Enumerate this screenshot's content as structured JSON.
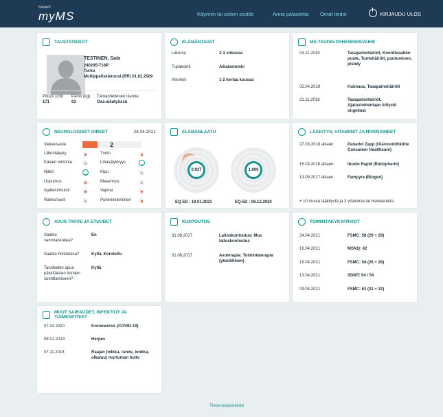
{
  "header": {
    "logo_small": "Stellar©",
    "logo_big": "myMS",
    "nav": [
      "Käynnin tai soiton sisältö",
      "Anna palautetta",
      "Omat tiedot"
    ],
    "logout": "KIRJAUDU ULOS"
  },
  "tausta": {
    "title": "TAUSTATIEDOT",
    "name": "TESTINEN, Salo",
    "id": "240295-716P",
    "city": "Turku",
    "diagnosis": "Multippeliskleroosi (RR) 01.02.2009",
    "height_label": "Pituus (cm)",
    "height": "171",
    "weight_label": "Paino (kg)",
    "weight": "63",
    "status_label": "Tämänhetkinen tilanne",
    "status": "Osa-aikatyössä"
  },
  "elama": {
    "title": "ELÄMÄNTAVAT",
    "rows": [
      {
        "label": "Liikunta",
        "value": "2-3 viikossa"
      },
      {
        "label": "Tupakointi",
        "value": "Aikaisemmin"
      },
      {
        "label": "Alkoholi",
        "value": "1-2 kertaa kuussa"
      }
    ]
  },
  "pahen": {
    "title": "MS-TAUDIN PAHENEMISVAIHE",
    "rows": [
      {
        "date": "04.11.2019",
        "value": "Tasapainohäiriöt, Koordinaation puute, Tuntohäiriöt, puutuminen, pistely"
      },
      {
        "date": "02.04.2019",
        "value": "Huimaus, Tasapainohäiriöt"
      },
      {
        "date": "21.11.2018",
        "value": "Tasapainohäiriöt, Ajatustoimintaan liittyvät ongelmat"
      }
    ]
  },
  "neuro": {
    "title": "NEUROLOGISET OIREET",
    "date": "24.04.2021",
    "severity_label": "Vaikeusaste",
    "severity": "2",
    "left": [
      "Liikuntakyky",
      "Käsien toiminta",
      "Näkö",
      "Uupumus",
      "Ajattelu/muisti",
      "Rakko/suoli"
    ],
    "right": [
      "Tunto",
      "Lihasjäykkyys",
      "Kipu",
      "Masennus",
      "Vapina",
      "Puhe/nieleminen"
    ]
  },
  "laatu": {
    "title": "ELÄMÄNLAATU",
    "v1": "0.937",
    "v2": "1.000",
    "l1": "EQ-5D : 19.01.2021",
    "l2": "EQ-5D : 08.12.2020"
  },
  "laak": {
    "title": "LÄÄKITYS, VITAMIINIT JA HIVENAINEET",
    "rows": [
      {
        "date": "27.03.2018 alkaen",
        "value": "Panadol Zapp (Glaxosmithkline Consumer Healthcare)"
      },
      {
        "date": "15.03.2018 alkaen",
        "value": "Ibuxin Rapid (Ratiopharm)"
      },
      {
        "date": "13.09.2017 alkaen",
        "value": "Fampyra (Biogen)"
      }
    ],
    "more": "+ 10 muuta lääkitystä ja 3 vitamiinia tai hivenainetta"
  },
  "avun": {
    "title": "AVUN TARVE JA ETUUDET",
    "rows": [
      {
        "label": "Saatko vammaistukea?",
        "value": "En"
      },
      {
        "label": "Saatko hoitotukea?",
        "value": "Kyllä, Korotettu"
      },
      {
        "label": "Tarvitsetko apua päivittäisten toimien suorittamiseen?",
        "value": "Kyllä"
      }
    ]
  },
  "kunto": {
    "title": "KUNTOUTUS",
    "rows": [
      {
        "date": "31.08.2017",
        "value": "Laitoskuntoutus: Muu laitoskuntoutus"
      },
      {
        "date": "01.08.2017",
        "value": "Avoterapia: Toimintaterapia (yksilöllinen)"
      }
    ]
  },
  "toim": {
    "title": "TOIMINTAKYKYARVIOT",
    "rows": [
      {
        "date": "24.04.2021",
        "value": "FSMC: 58 (29 + 29)"
      },
      {
        "date": "19.04.2021",
        "value": "MSNQ: 42"
      },
      {
        "date": "19.04.2021",
        "value": "FSMC: 54 (26 + 28)"
      },
      {
        "date": "13.04.2021",
        "value": "SDMT: 54 / 54"
      },
      {
        "date": "09.04.2021",
        "value": "FSMC: 63 (31 + 32)"
      }
    ]
  },
  "muut": {
    "title": "MUUT SAIRAUDET, INFEKTIOT JA TOIMENPITEET",
    "rows": [
      {
        "date": "07.04.2020",
        "value": "Koronavirus (COVID-19)"
      },
      {
        "date": "08.01.2019",
        "value": "Herpes"
      },
      {
        "date": "07.11.2018",
        "value": "Raajan (nilkka, ranne, lonkka, olkaluu) murtuman hoito"
      }
    ]
  },
  "footer": "Tietosuojaseloste"
}
